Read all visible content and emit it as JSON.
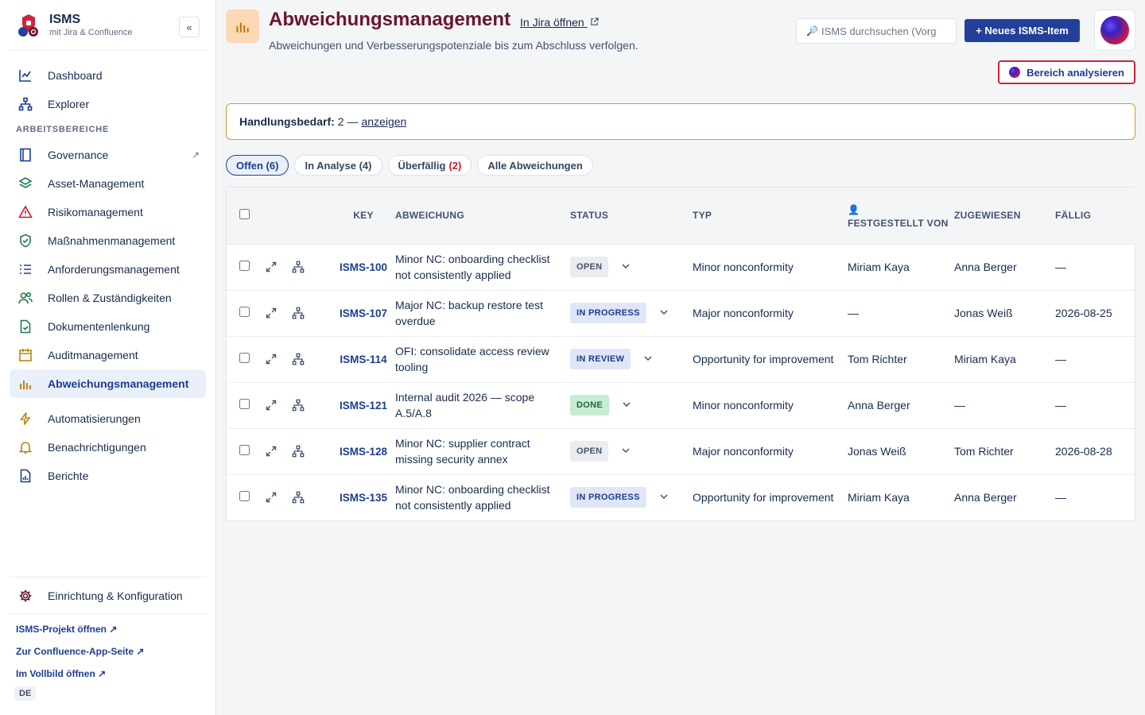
{
  "brand": {
    "title": "ISMS",
    "subtitle": "mit Jira & Confluence",
    "collapse": "«"
  },
  "nav_top": [
    {
      "label": "Dashboard",
      "icon": "chart-line-icon"
    },
    {
      "label": "Explorer",
      "icon": "hierarchy-icon"
    }
  ],
  "section_label": "ARBEITSBEREICHE",
  "nav_areas": [
    {
      "label": "Governance",
      "icon": "book-icon",
      "ext": "↗"
    },
    {
      "label": "Asset-Management",
      "icon": "layers-icon"
    },
    {
      "label": "Risikomanagement",
      "icon": "warning-icon"
    },
    {
      "label": "Maßnahmenmanagement",
      "icon": "shield-check-icon"
    },
    {
      "label": "Anforderungsmanagement",
      "icon": "checklist-icon"
    },
    {
      "label": "Rollen & Zuständigkeiten",
      "icon": "people-icon"
    },
    {
      "label": "Dokumentenlenkung",
      "icon": "document-check-icon"
    },
    {
      "label": "Auditmanagement",
      "icon": "calendar-icon"
    },
    {
      "label": "Abweichungsmanagement",
      "icon": "bar-chart-icon",
      "active": true
    }
  ],
  "nav_more": [
    {
      "label": "Automatisierungen",
      "icon": "lightning-icon"
    },
    {
      "label": "Benachrichtigungen",
      "icon": "bell-icon"
    },
    {
      "label": "Berichte",
      "icon": "report-icon"
    }
  ],
  "setup": {
    "label": "Einrichtung & Konfiguration"
  },
  "footer_links": [
    "ISMS-Projekt öffnen ↗",
    "Zur Confluence-App-Seite ↗",
    "Im Vollbild öffnen ↗"
  ],
  "language": "DE",
  "header": {
    "title": "Abweichungsmanagement",
    "jira_link": "In Jira öffnen",
    "subtitle": "Abweichungen und Verbesserungspotenziale bis zum Abschluss verfolgen.",
    "search_placeholder": "ISMS durchsuchen (Vorg",
    "new_button": "+ Neues ISMS-Item",
    "analyze_button": "Bereich analysieren"
  },
  "alert": {
    "label": "Handlungsbedarf:",
    "count_text": "2 —",
    "link": "anzeigen",
    "border_color": "#c9a227"
  },
  "tabs": [
    {
      "label": "Offen (6)",
      "active": true
    },
    {
      "label": "In Analyse (4)"
    },
    {
      "label": "Überfällig",
      "count": "(2)"
    },
    {
      "label": "Alle Abweichungen"
    }
  ],
  "table": {
    "headers": {
      "key": "KEY",
      "abweichung": "ABWEICHUNG",
      "status": "STATUS",
      "typ": "TYP",
      "festgestellt": "FESTGESTELLT VON",
      "zugewiesen": "ZUGEWIESEN",
      "faellig": "FÄLLIG"
    },
    "rows": [
      {
        "key": "ISMS-100",
        "title": "Minor NC: onboarding checklist not consistently applied",
        "status": "OPEN",
        "status_kind": "open",
        "typ": "Minor nonconformity",
        "festgestellt": "Miriam Kaya",
        "zugewiesen": "Anna Berger",
        "faellig": "—"
      },
      {
        "key": "ISMS-107",
        "title": "Major NC: backup restore test overdue",
        "status": "IN PROGRESS",
        "status_kind": "progress",
        "typ": "Major nonconformity",
        "festgestellt": "—",
        "zugewiesen": "Jonas Weiß",
        "faellig": "2026-08-25"
      },
      {
        "key": "ISMS-114",
        "title": "OFI: consolidate access review tooling",
        "status": "IN REVIEW",
        "status_kind": "review",
        "typ": "Opportunity for improvement",
        "festgestellt": "Tom Richter",
        "zugewiesen": "Miriam Kaya",
        "faellig": "—"
      },
      {
        "key": "ISMS-121",
        "title": "Internal audit 2026 — scope A.5/A.8",
        "status": "DONE",
        "status_kind": "done",
        "typ": "Minor nonconformity",
        "festgestellt": "Anna Berger",
        "zugewiesen": "—",
        "faellig": "—"
      },
      {
        "key": "ISMS-128",
        "title": "Minor NC: supplier contract missing security annex",
        "status": "OPEN",
        "status_kind": "open",
        "typ": "Major nonconformity",
        "festgestellt": "Jonas Weiß",
        "zugewiesen": "Tom Richter",
        "faellig": "2026-08-28"
      },
      {
        "key": "ISMS-135",
        "title": "Minor NC: onboarding checklist not consistently applied",
        "status": "IN PROGRESS",
        "status_kind": "progress",
        "typ": "Opportunity for improvement",
        "festgestellt": "Miriam Kaya",
        "zugewiesen": "Anna Berger",
        "faellig": "—"
      }
    ]
  },
  "colors": {
    "accent": "#22409a",
    "title": "#6b1530",
    "danger": "#d1233c"
  }
}
